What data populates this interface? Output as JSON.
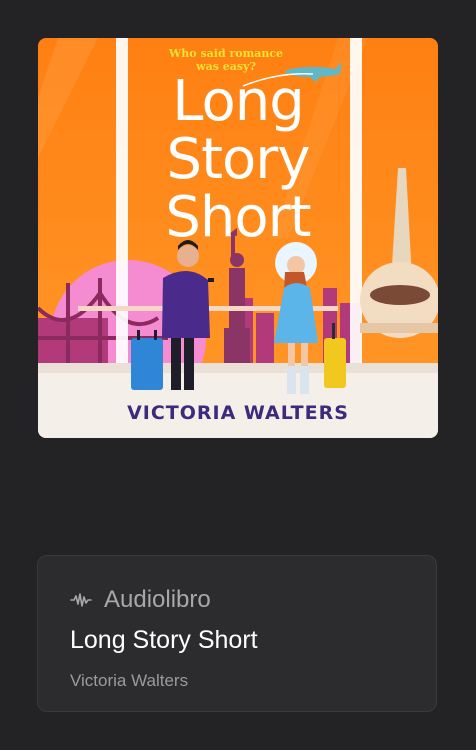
{
  "cover": {
    "tagline_line1": "Who said romance",
    "tagline_line2": "was easy?",
    "title_line1": "Long",
    "title_line2": "Story",
    "title_line3": "Short",
    "author": "VICTORIA WALTERS"
  },
  "info_card": {
    "badge_icon": "audio-wave-icon",
    "badge_label": "Audiolibro",
    "title": "Long Story Short",
    "author": "Victoria Walters"
  },
  "colors": {
    "background": "#232325",
    "card": "#2c2c2e",
    "cover_orange": "#ff8a1c",
    "author_purple": "#3d2a7c"
  }
}
